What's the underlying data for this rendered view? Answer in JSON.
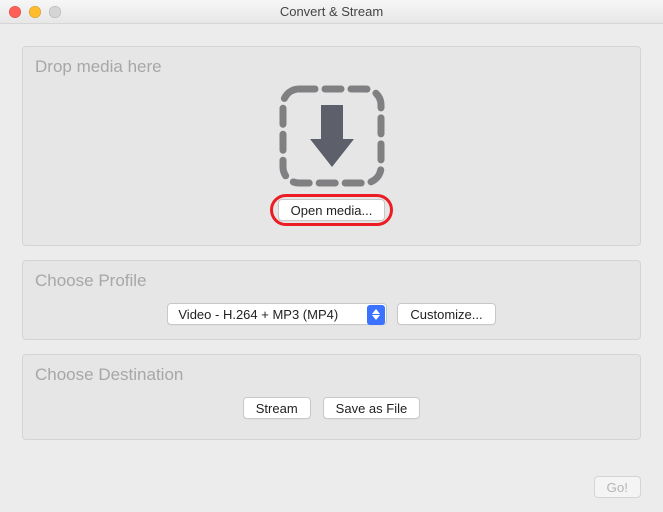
{
  "window": {
    "title": "Convert & Stream"
  },
  "drop": {
    "title": "Drop media here",
    "open_media_label": "Open media..."
  },
  "profile": {
    "title": "Choose Profile",
    "selected": "Video - H.264 + MP3 (MP4)",
    "customize_label": "Customize..."
  },
  "destination": {
    "title": "Choose Destination",
    "stream_label": "Stream",
    "save_as_file_label": "Save as File"
  },
  "footer": {
    "go_label": "Go!"
  }
}
